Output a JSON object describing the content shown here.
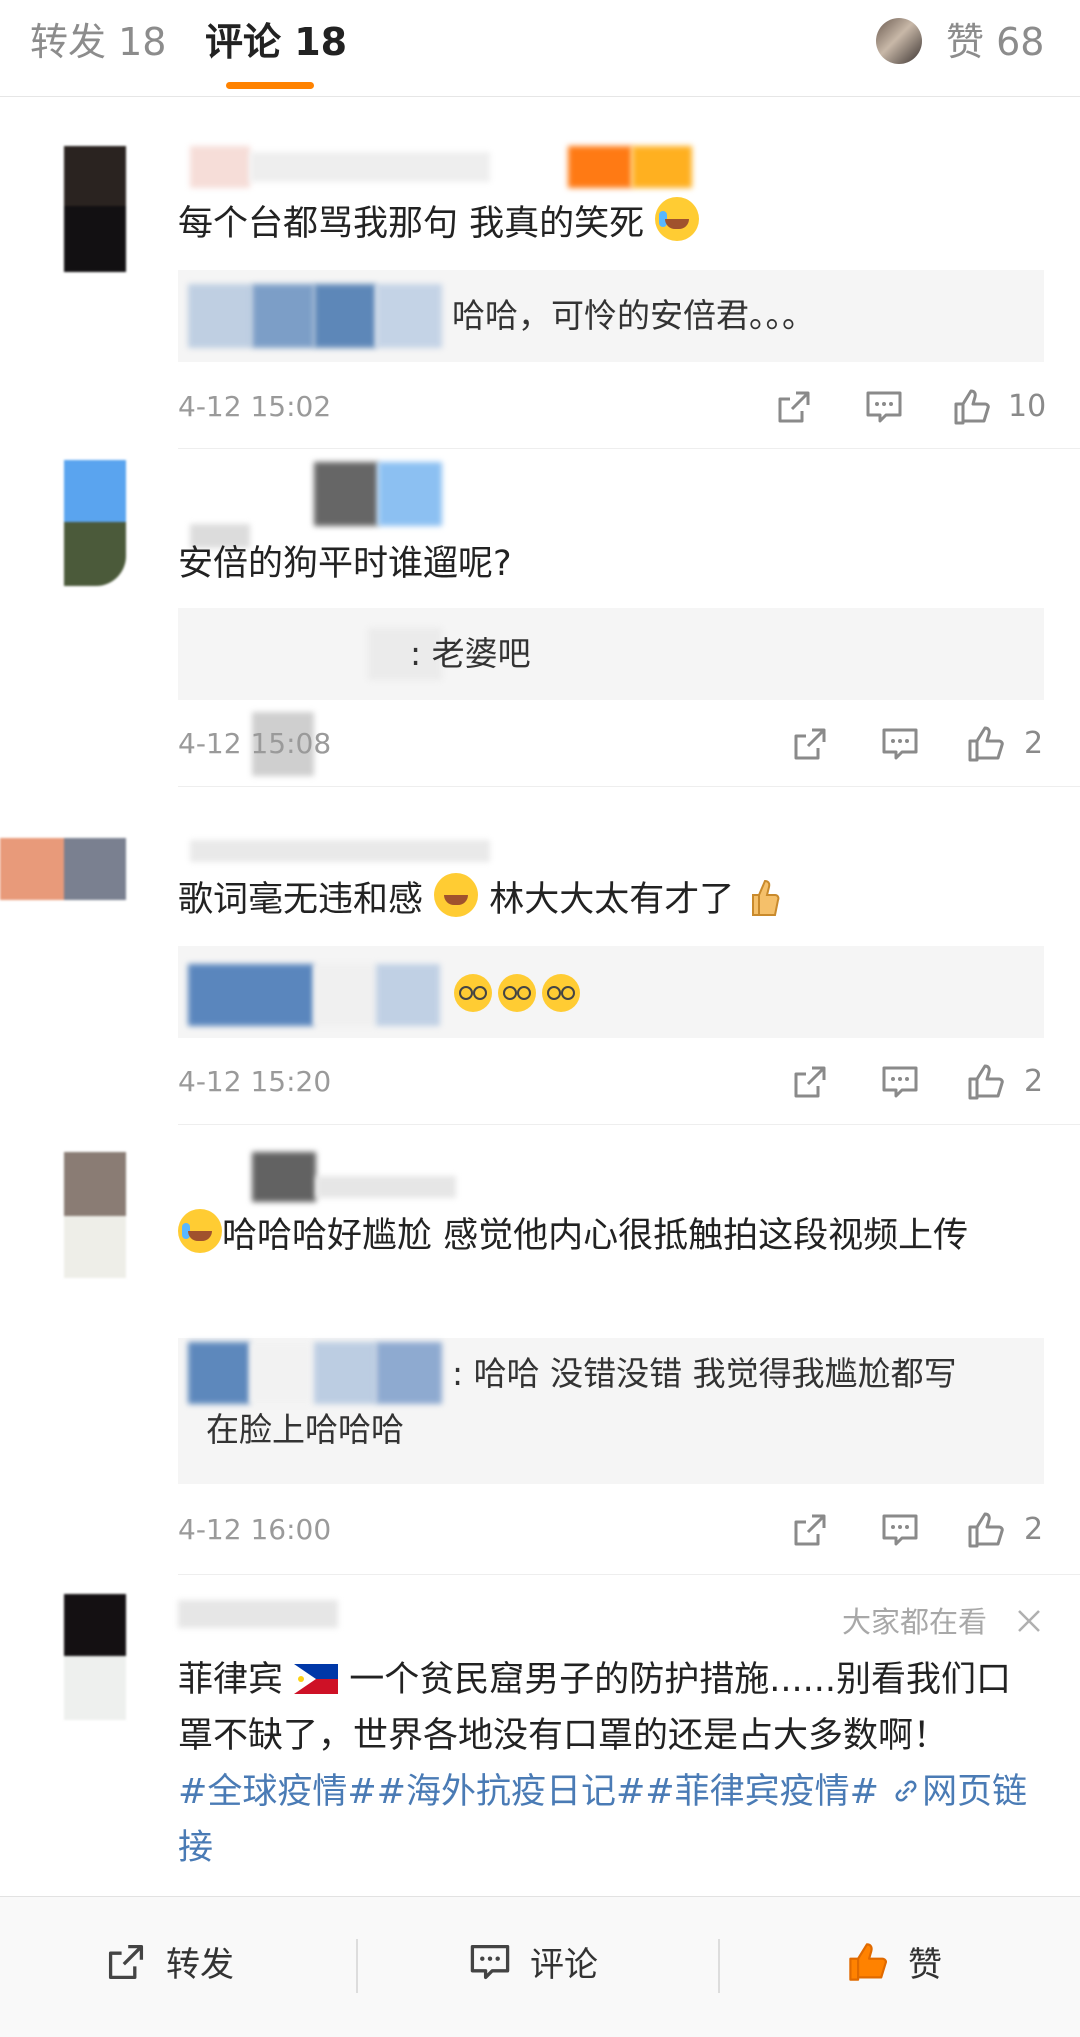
{
  "tabs": {
    "repost_label": "转发 18",
    "comment_label": "评论 18",
    "like_label": "赞 68"
  },
  "comments": [
    {
      "text": "每个台都骂我那句 我真的笑死",
      "reply": "哈哈，可怜的安倍君。。。",
      "time": "4-12 15:02",
      "likes": "10"
    },
    {
      "text": "安倍的狗平时谁遛呢?",
      "reply": ": 老婆吧",
      "time": "4-12 15:08",
      "likes": "2"
    },
    {
      "text_a": "歌词毫无违和感",
      "text_b": "林大大太有才了",
      "reply": "",
      "time": "4-12 15:20",
      "likes": "2"
    },
    {
      "text": "哈哈哈好尴尬 感觉他内心很抵触拍这段视频上传",
      "reply_line1": ": 哈哈 没错没错 我觉得我尴尬都写",
      "reply_line2": "在脸上哈哈哈",
      "time": "4-12 16:00",
      "likes": "2"
    }
  ],
  "recommended": {
    "label": "大家都在看",
    "text_a": "菲律宾",
    "text_b": "一个贫民窟男子的防护措施......别看我们口罩不缺了，世界各地没有口罩的还是占大多数啊！",
    "hashtags": "#全球疫情##海外抗疫日记##菲律宾疫情#",
    "link_label": "网页链接"
  },
  "bottom_bar": {
    "repost": "转发",
    "comment": "评论",
    "like": "赞"
  },
  "colors": {
    "accent": "#ff8200",
    "link": "#4a7bb5"
  }
}
